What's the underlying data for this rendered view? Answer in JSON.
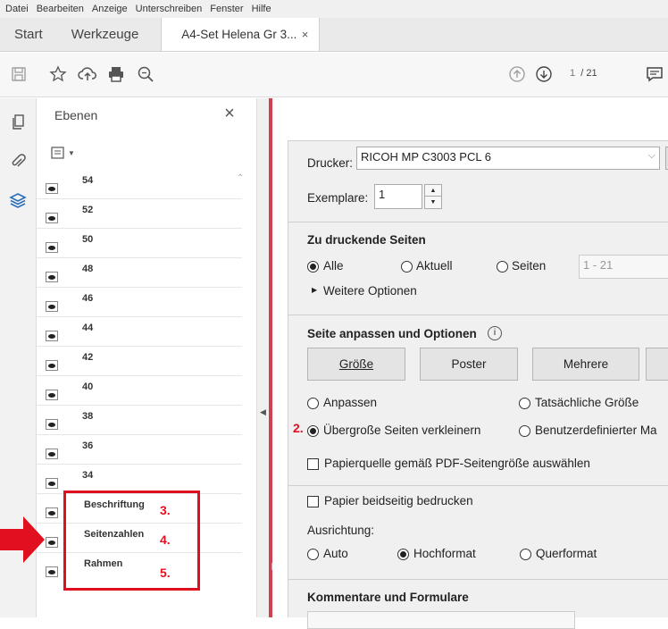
{
  "menu": [
    "Datei",
    "Bearbeiten",
    "Anzeige",
    "Unterschreiben",
    "Fenster",
    "Hilfe"
  ],
  "tabs": {
    "start": "Start",
    "tools": "Werkzeuge",
    "doc": "A4-Set Helena Gr 3...",
    "close": "×"
  },
  "toolbar": {
    "page_current": "1",
    "page_total": "/ 21"
  },
  "layers_panel": {
    "title": "Ebenen",
    "close": "×",
    "rows": [
      "54",
      "52",
      "50",
      "48",
      "46",
      "44",
      "42",
      "40",
      "38",
      "36",
      "34",
      "Beschriftung",
      "Seitenzahlen",
      "Rahmen"
    ],
    "annotations": [
      "3.",
      "4.",
      "5."
    ]
  },
  "print_dialog": {
    "printer_label": "Drucker:",
    "printer_value": "RICOH MP C3003 PCL 6",
    "copies_label": "Exemplare:",
    "copies_value": "1",
    "pages_heading": "Zu druckende Seiten",
    "radio_all": "Alle",
    "radio_current": "Aktuell",
    "radio_pages": "Seiten",
    "pages_range": "1 - 21",
    "more_options": "Weitere Optionen",
    "fit_heading": "Seite anpassen und Optionen",
    "info_icon": "i",
    "btn_size": "Größe",
    "btn_poster": "Poster",
    "btn_multiple": "Mehrere",
    "radio_fit": "Anpassen",
    "radio_actual": "Tatsächliche Größe",
    "radio_shrink": "Übergroße Seiten verkleinern",
    "radio_custom": "Benutzerdefinierter Ma",
    "annotation_2": "2.",
    "chk_papersource": "Papierquelle gemäß PDF-Seitengröße auswählen",
    "chk_duplex": "Papier beidseitig bedrucken",
    "orientation_label": "Ausrichtung:",
    "radio_auto": "Auto",
    "radio_portrait": "Hochformat",
    "radio_landscape": "Querformat",
    "comments_heading": "Kommentare und Formulare"
  },
  "colors": {
    "annotation_red": "#e01020",
    "accent_blue": "#2a6ebb"
  }
}
